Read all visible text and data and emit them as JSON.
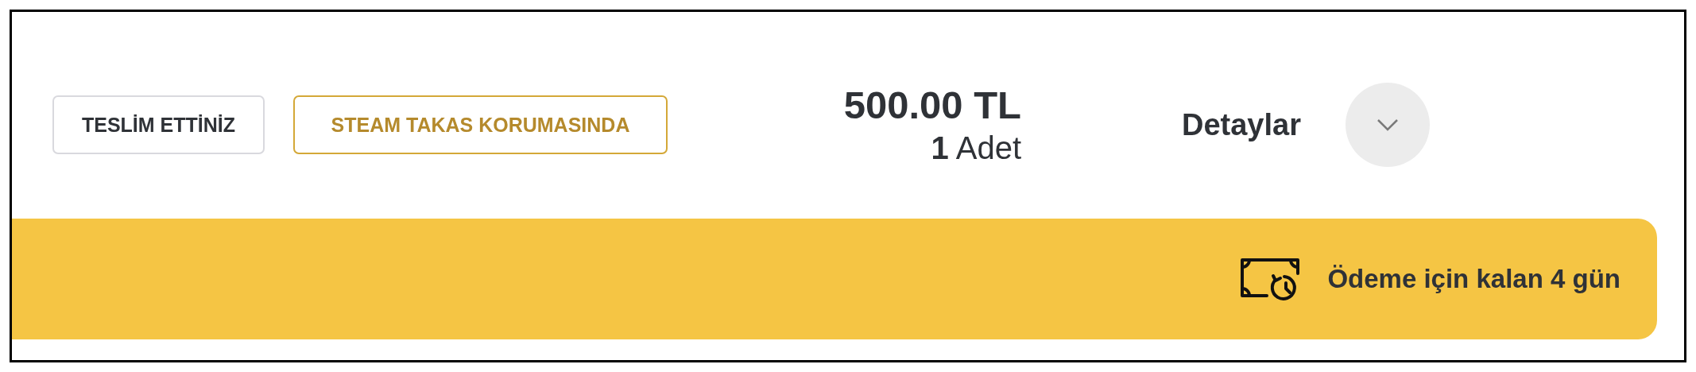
{
  "status_badges": [
    {
      "label": "TESLİM ETTİNİZ",
      "kind": "neutral"
    },
    {
      "label": "STEAM TAKAS KORUMASINDA",
      "kind": "warning"
    }
  ],
  "price": {
    "amount": "500.00 TL",
    "quantity": "**1** Adet"
  },
  "details_toggle": {
    "label": "Detaylar",
    "expanded": false
  },
  "payment_notice": {
    "text": "Ödeme için kalan 4 gün"
  }
}
